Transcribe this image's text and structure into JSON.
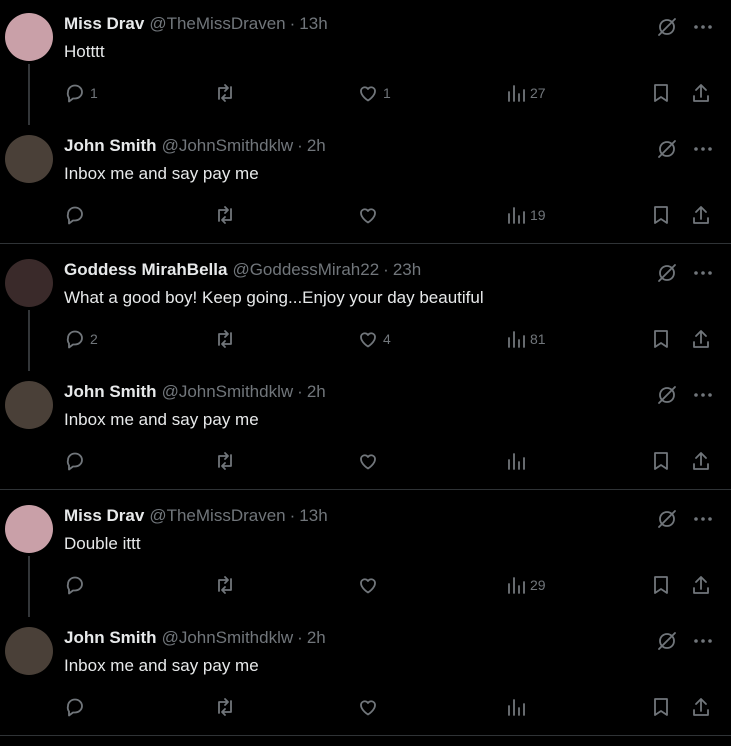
{
  "tweets": [
    {
      "name": "Miss Drav",
      "handle": "@TheMissDraven",
      "sep": "·",
      "time": "13h",
      "text": "Hotttt",
      "replies": "1",
      "retweets": "",
      "likes": "1",
      "views": "27",
      "avatar_color": "#c9a0a8"
    },
    {
      "name": "John Smith",
      "handle": "@JohnSmithdklw",
      "sep": "·",
      "time": "2h",
      "text": "Inbox me and say pay me",
      "replies": "",
      "retweets": "",
      "likes": "",
      "views": "19",
      "avatar_color": "#4a4038"
    },
    {
      "name": "Goddess MirahBella",
      "handle": "@GoddessMirah22",
      "sep": "·",
      "time": "23h",
      "text": "What a good boy! Keep going...Enjoy your day beautiful",
      "replies": "2",
      "retweets": "",
      "likes": "4",
      "views": "81",
      "avatar_color": "#3a2a2a"
    },
    {
      "name": "John Smith",
      "handle": "@JohnSmithdklw",
      "sep": "·",
      "time": "2h",
      "text": "Inbox me and say pay me",
      "replies": "",
      "retweets": "",
      "likes": "",
      "views": "",
      "avatar_color": "#4a4038"
    },
    {
      "name": "Miss Drav",
      "handle": "@TheMissDraven",
      "sep": "·",
      "time": "13h",
      "text": "Double ittt",
      "replies": "",
      "retweets": "",
      "likes": "",
      "views": "29",
      "avatar_color": "#c9a0a8"
    },
    {
      "name": "John Smith",
      "handle": "@JohnSmithdklw",
      "sep": "·",
      "time": "2h",
      "text": "Inbox me and say pay me",
      "replies": "",
      "retweets": "",
      "likes": "",
      "views": "",
      "avatar_color": "#4a4038"
    }
  ],
  "icons": {
    "grok": "grok-icon",
    "more": "more-icon",
    "reply": "reply-icon",
    "retweet": "retweet-icon",
    "like": "like-icon",
    "views": "views-icon",
    "bookmark": "bookmark-icon",
    "share": "share-icon"
  },
  "colors": {
    "background": "#000000",
    "text": "#e7e9ea",
    "muted": "#71767b",
    "divider": "#2f3336"
  }
}
